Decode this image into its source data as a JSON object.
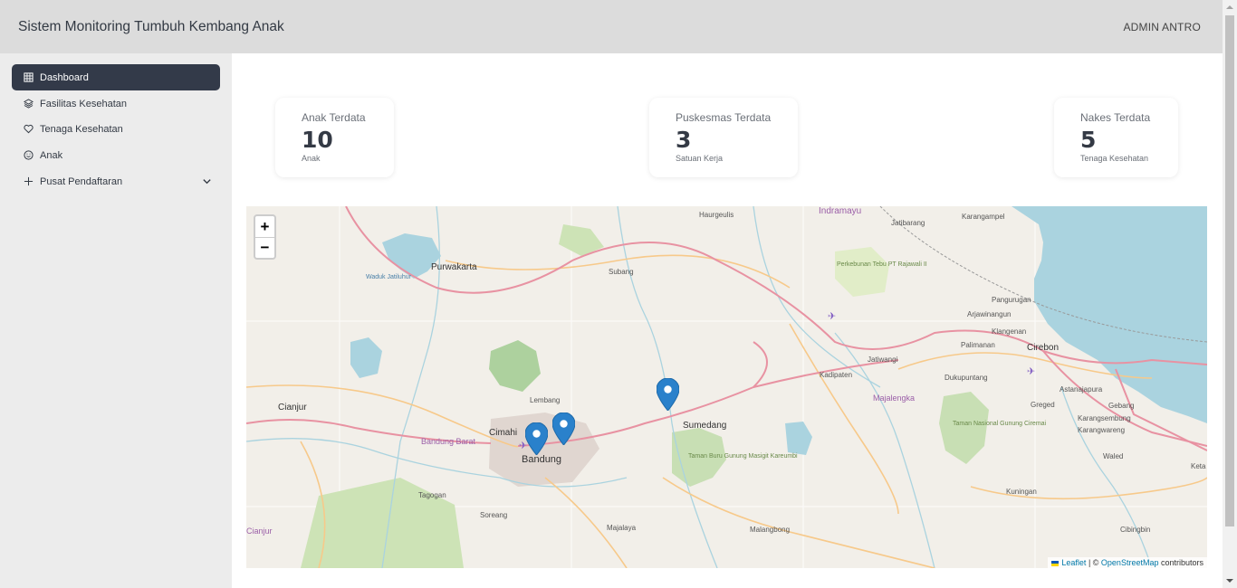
{
  "header": {
    "title": "Sistem Monitoring Tumbuh Kembang Anak",
    "user": "ADMIN ANTRO"
  },
  "sidebar": {
    "items": [
      {
        "label": "Dashboard",
        "icon": "grid-icon",
        "active": true
      },
      {
        "label": "Fasilitas Kesehatan",
        "icon": "layers-icon"
      },
      {
        "label": "Tenaga Kesehatan",
        "icon": "heart-icon"
      },
      {
        "label": "Anak",
        "icon": "smile-icon"
      },
      {
        "label": "Pusat Pendaftaran",
        "icon": "plus-icon",
        "expandable": true
      }
    ]
  },
  "stats": [
    {
      "label": "Anak Terdata",
      "value": "10",
      "unit": "Anak"
    },
    {
      "label": "Puskesmas Terdata",
      "value": "3",
      "unit": "Satuan Kerja"
    },
    {
      "label": "Nakes Terdata",
      "value": "5",
      "unit": "Tenaga Kesehatan"
    }
  ],
  "map": {
    "zoom_in": "+",
    "zoom_out": "−",
    "marker_count": 3,
    "attribution": {
      "leaflet": "Leaflet",
      "separator": " | © ",
      "osm": "OpenStreetMap",
      "suffix": " contributors"
    },
    "place_labels": [
      "Indramayu",
      "Haurgeulis",
      "Jatibarang",
      "Karangampel",
      "Purwakarta",
      "Subang",
      "Pangurugan",
      "Arjawinangun",
      "Klangenan",
      "Cirebon",
      "Palimanan",
      "Kadipaten",
      "Jatiwangi",
      "Dukupuntang",
      "Astanajapura",
      "Gebang",
      "Cianjur",
      "Lembang",
      "Cimahi",
      "Bandung",
      "Sumedang",
      "Majalengka",
      "Greged",
      "Karangsembung",
      "Karangwareng",
      "Waled",
      "Kuningan",
      "Tagogan",
      "Soreang",
      "Majalaya",
      "Malangbong",
      "Cibingbin",
      "Cianjur",
      "Bandung Barat",
      "Perkebunan Tebu PT Rajawali II",
      "Taman Nasional Gunung Ciremai",
      "Taman Buru Gunung Masigit Kareumbi",
      "Waduk Jatiluhur",
      "Keta"
    ],
    "colors": {
      "water": "#aad3df",
      "forest": "#add19e",
      "road_primary": "#e892a2",
      "road_secondary": "#f7c98a",
      "marker": "#2a81cb"
    }
  }
}
